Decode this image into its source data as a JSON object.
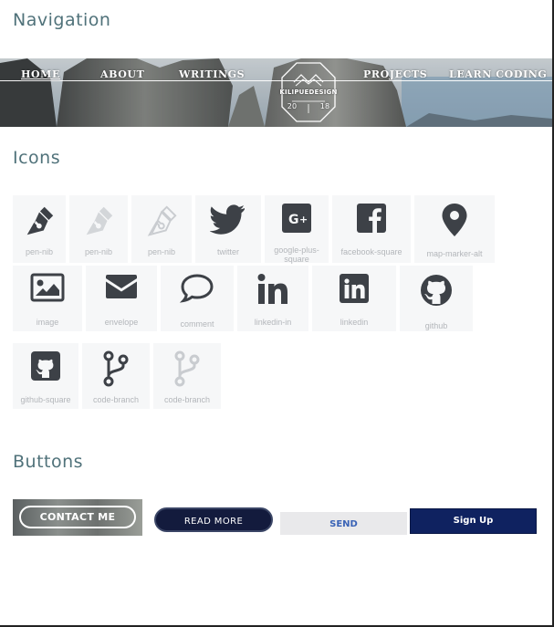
{
  "sections": {
    "navigation_title": "Navigation",
    "icons_title": "Icons",
    "buttons_title": "Buttons"
  },
  "nav": {
    "links": [
      "HOME",
      "ABOUT",
      "WRITINGS",
      "PROJECTS",
      "LEARN CODING"
    ],
    "logo": {
      "name": "KILIPUEDESIGN",
      "year_left": "20",
      "year_right": "18"
    }
  },
  "icons": [
    {
      "label": "pen-nib",
      "icon": "pen-nib-icon",
      "style": "dark"
    },
    {
      "label": "pen-nib",
      "icon": "pen-nib-icon",
      "style": "faded"
    },
    {
      "label": "pen-nib",
      "icon": "pen-nib-icon",
      "style": "outline"
    },
    {
      "label": "twitter",
      "icon": "twitter-icon",
      "style": "dark"
    },
    {
      "label": "google-plus-square",
      "icon": "google-plus-square-icon",
      "style": "dark"
    },
    {
      "label": "facebook-square",
      "icon": "facebook-square-icon",
      "style": "dark"
    },
    {
      "label": "map-marker-alt",
      "icon": "map-marker-alt-icon",
      "style": "dark"
    },
    {
      "label": "image",
      "icon": "image-icon",
      "style": "dark"
    },
    {
      "label": "envelope",
      "icon": "envelope-icon",
      "style": "dark"
    },
    {
      "label": "comment",
      "icon": "comment-icon",
      "style": "dark"
    },
    {
      "label": "linkedin-in",
      "icon": "linkedin-in-icon",
      "style": "dark"
    },
    {
      "label": "linkedin",
      "icon": "linkedin-icon",
      "style": "dark"
    },
    {
      "label": "github",
      "icon": "github-icon",
      "style": "dark"
    },
    {
      "label": "github-square",
      "icon": "github-square-icon",
      "style": "dark"
    },
    {
      "label": "code-branch",
      "icon": "code-branch-icon",
      "style": "dark"
    },
    {
      "label": "code-branch",
      "icon": "code-branch-icon",
      "style": "faded"
    }
  ],
  "buttons": {
    "contact": "CONTACT ME",
    "read_more": "READ MORE",
    "send": "SEND",
    "signup": "Sign Up"
  },
  "colors": {
    "heading": "#50727a",
    "icon_dark": "#3d4147",
    "icon_faded": "#c3c7cb",
    "tile_bg": "#f6f7f8",
    "navy": "#131b3d",
    "signup_bg": "#0f2260",
    "send_text": "#3a63b6"
  }
}
